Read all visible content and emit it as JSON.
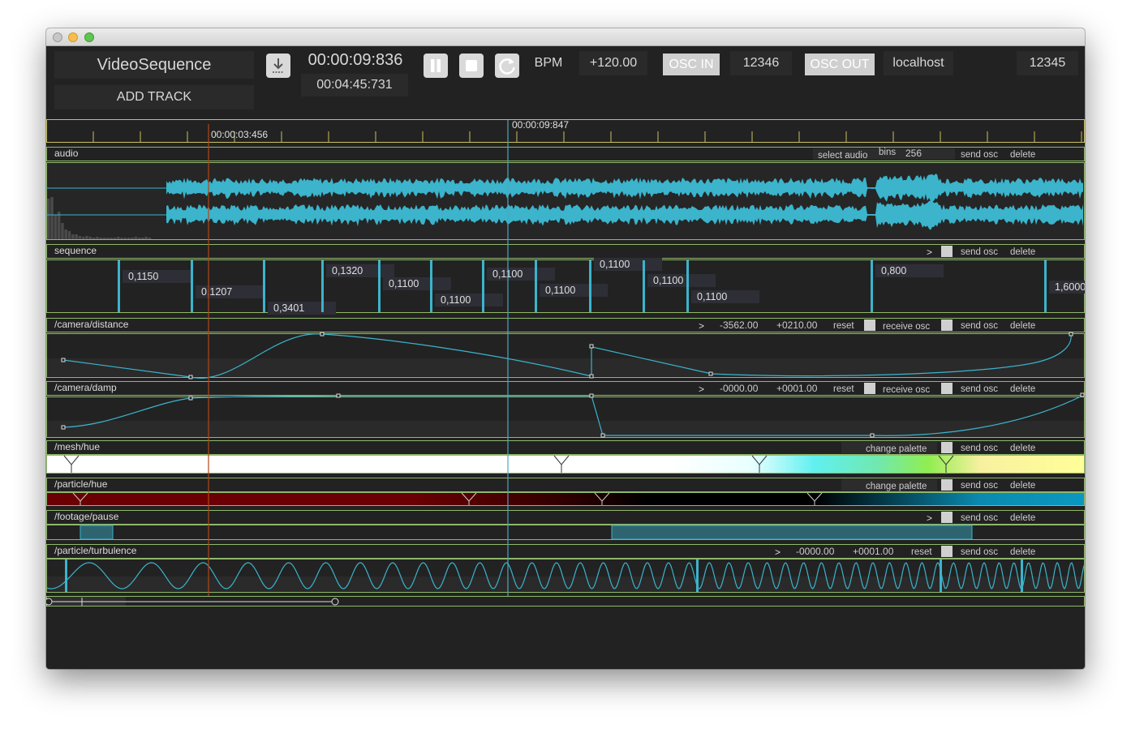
{
  "app": {
    "title": "VideoSequence",
    "add_track": "ADD TRACK"
  },
  "transport": {
    "current_time": "00:00:09:836",
    "duration": "00:04:45:731",
    "bpm_label": "BPM",
    "bpm_value": "+120.00"
  },
  "osc": {
    "in_label": "OSC IN",
    "in_port": "12346",
    "out_label": "OSC OUT",
    "out_host": "localhost",
    "out_port": "12345"
  },
  "timeline": {
    "marker_left": "00:00:03:456",
    "marker_right": "00:00:09:847"
  },
  "tracks": {
    "audio": {
      "name": "audio",
      "select_audio": "select audio",
      "bins_label": "bins",
      "bins_value": "256",
      "send_osc": "send osc",
      "delete": "delete"
    },
    "sequence": {
      "name": "sequence",
      "arrow": ">",
      "send_osc": "send osc",
      "delete": "delete",
      "values": [
        "0,1150",
        "0,1207",
        "0,3401",
        "0,1320",
        "0,1100",
        "0,1100",
        "0,1100",
        "0,1100",
        "0,1100",
        "0,1100",
        "0,1100",
        "0,800",
        "1,6000"
      ]
    },
    "camera_distance": {
      "name": "/camera/distance",
      "arrow": ">",
      "min": "-3562.00",
      "max": "+0210.00",
      "reset": "reset",
      "receive_osc": "receive osc",
      "send_osc": "send osc",
      "delete": "delete"
    },
    "camera_damp": {
      "name": "/camera/damp",
      "arrow": ">",
      "min": "-0000.00",
      "max": "+0001.00",
      "reset": "reset",
      "receive_osc": "receive osc",
      "send_osc": "send osc",
      "delete": "delete"
    },
    "mesh_hue": {
      "name": "/mesh/hue",
      "arrow": ">",
      "change_palette": "change palette",
      "send_osc": "send osc",
      "delete": "delete"
    },
    "particle_hue": {
      "name": "/particle/hue",
      "arrow": ">",
      "change_palette": "change palette",
      "send_osc": "send osc",
      "delete": "delete"
    },
    "footage_pause": {
      "name": "/footage/pause",
      "arrow": ">",
      "send_osc": "send osc",
      "delete": "delete"
    },
    "particle_turbulence": {
      "name": "/particle/turbulence",
      "arrow": ">",
      "min": "-0000.00",
      "max": "+0001.00",
      "reset": "reset",
      "send_osc": "send osc",
      "delete": "delete"
    }
  },
  "colors": {
    "accent": "#3bb4cc",
    "frame": "#8fb86a",
    "ruler": "#c8c060",
    "playhead": "#4ca8c0",
    "cursor": "#b04818"
  },
  "icons": {
    "download": "download-icon",
    "pause": "pause-icon",
    "stop": "stop-icon",
    "loop": "loop-icon"
  }
}
